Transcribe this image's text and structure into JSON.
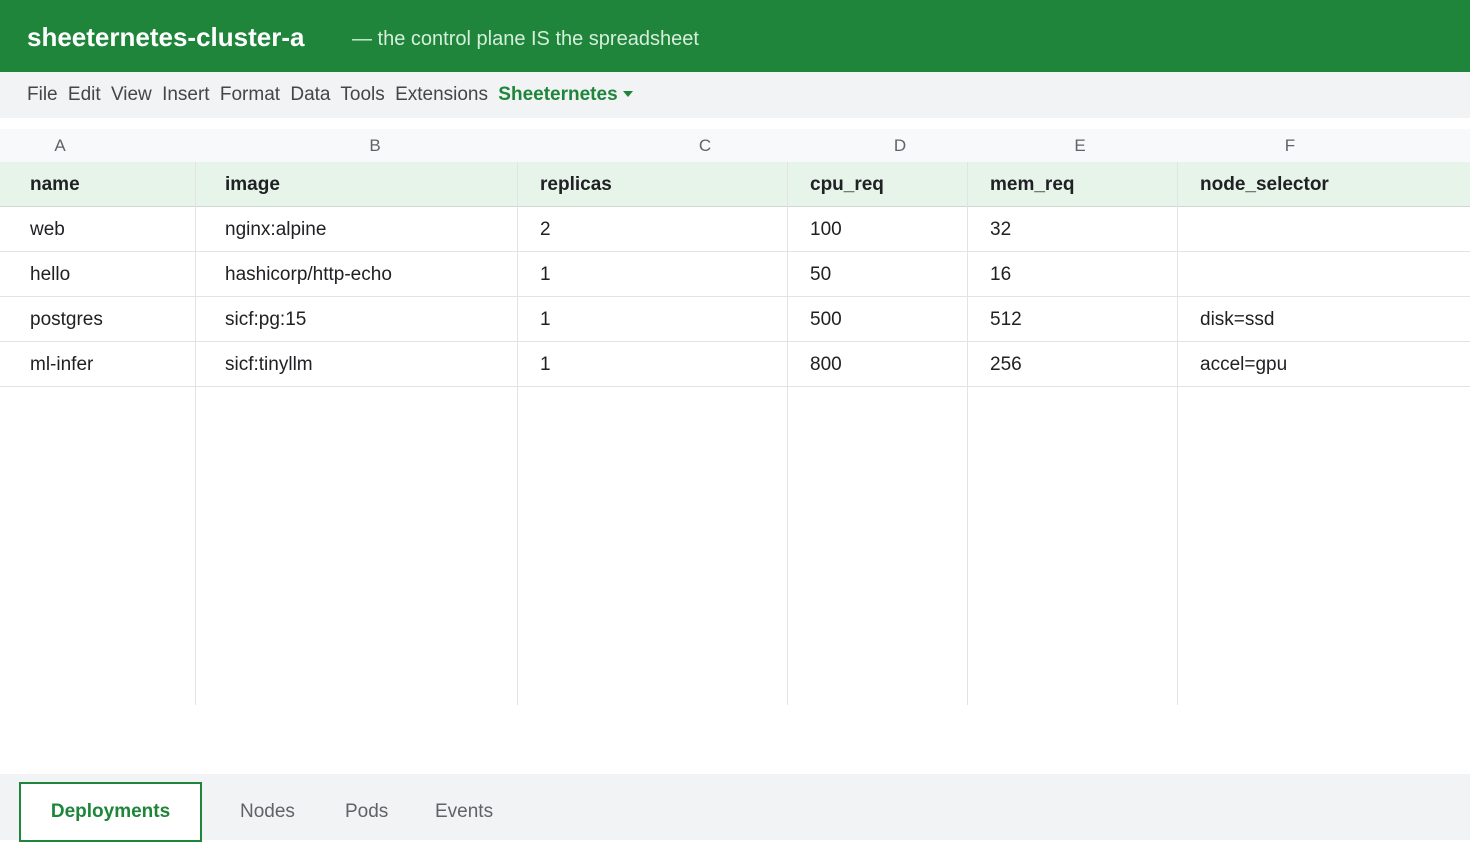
{
  "header": {
    "title": "sheeternetes-cluster-a",
    "subtitle": "— the control plane IS the spreadsheet"
  },
  "menu": {
    "items": [
      "File",
      "Edit",
      "View",
      "Insert",
      "Format",
      "Data",
      "Tools",
      "Extensions"
    ],
    "accent_item": "Sheeternetes",
    "accent_icon": "caret-down-icon"
  },
  "sheet": {
    "column_letters": [
      "A",
      "B",
      "C",
      "D",
      "E",
      "F"
    ],
    "headers": [
      "name",
      "image",
      "replicas",
      "cpu_req",
      "mem_req",
      "node_selector"
    ],
    "rows": [
      [
        "web",
        "nginx:alpine",
        "2",
        "100",
        "32",
        ""
      ],
      [
        "hello",
        "hashicorp/http-echo",
        "1",
        "50",
        "16",
        ""
      ],
      [
        "postgres",
        "sicf:pg:15",
        "1",
        "500",
        "512",
        "disk=ssd"
      ],
      [
        "ml-infer",
        "sicf:tinyllm",
        "1",
        "800",
        "256",
        "accel=gpu"
      ]
    ]
  },
  "tabs": {
    "items": [
      "Deployments",
      "Nodes",
      "Pods",
      "Events"
    ],
    "active": "Deployments"
  },
  "colors": {
    "brand": "#1e853a",
    "header_fill": "#e6f4ea",
    "chrome": "#f1f3f4"
  }
}
